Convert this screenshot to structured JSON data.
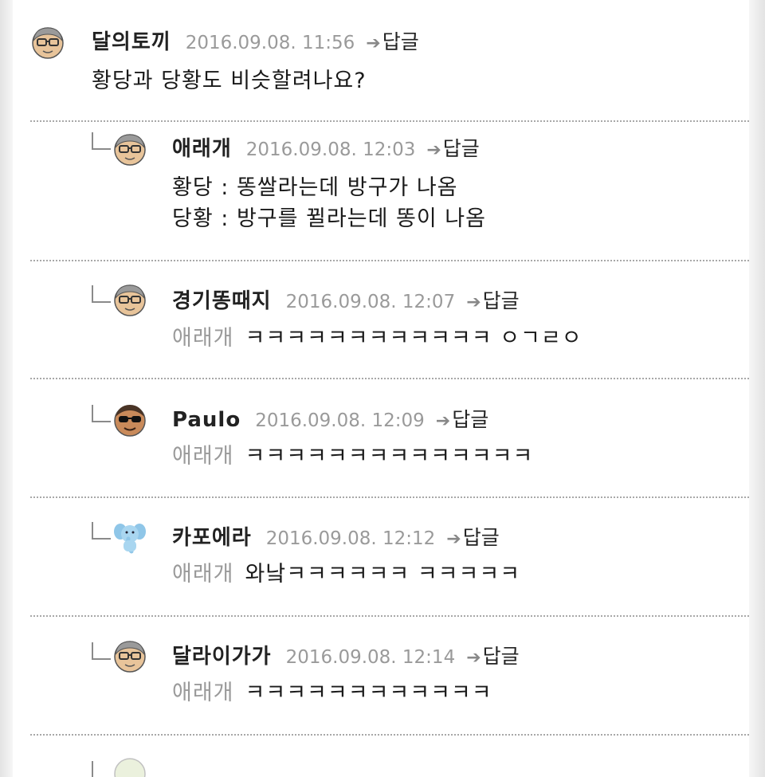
{
  "comments": [
    {
      "nickname": "달의토끼",
      "date": "2016.09.08. 11:56",
      "reply_label": "답글",
      "avatar_icon": "gray-hair-glasses-face-icon",
      "body": [
        "황당과 당황도 비슷할려나요?"
      ]
    },
    {
      "nickname": "애래개",
      "date": "2016.09.08. 12:03",
      "reply_label": "답글",
      "avatar_icon": "gray-hair-glasses-face-icon",
      "body": [
        "황당 : 똥쌀라는데 방구가 나옴",
        "당황 : 방구를 뀔라는데 똥이 나옴"
      ]
    },
    {
      "nickname": "경기똥때지",
      "date": "2016.09.08. 12:07",
      "reply_label": "답글",
      "avatar_icon": "gray-hair-glasses-face-icon",
      "mention": "애래개",
      "body_text": "ㅋㅋㅋㅋㅋㅋㅋㅋㅋㅋㅋㅋ ㅇㄱㄹㅇ"
    },
    {
      "nickname": "Paulo",
      "date": "2016.09.08. 12:09",
      "reply_label": "답글",
      "avatar_icon": "sunglasses-face-icon",
      "mention": "애래개",
      "body_text": "ㅋㅋㅋㅋㅋㅋㅋㅋㅋㅋㅋㅋㅋㅋ"
    },
    {
      "nickname": "카포에라",
      "date": "2016.09.08. 12:12",
      "reply_label": "답글",
      "avatar_icon": "blue-elephant-icon",
      "mention": "애래개",
      "body_text": "와낰ㅋㅋㅋㅋㅋㅋ ㅋㅋㅋㅋㅋ"
    },
    {
      "nickname": "달라이가가",
      "date": "2016.09.08. 12:14",
      "reply_label": "답글",
      "avatar_icon": "gray-hair-glasses-face-icon",
      "mention": "애래개",
      "body_text": "ㅋㅋㅋㅋㅋㅋㅋㅋㅋㅋㅋㅋ"
    }
  ],
  "colors": {
    "nickname": "#222222",
    "date": "#9a9a9a",
    "mention": "#9a9a9a",
    "divider": "#a8a8a8"
  }
}
